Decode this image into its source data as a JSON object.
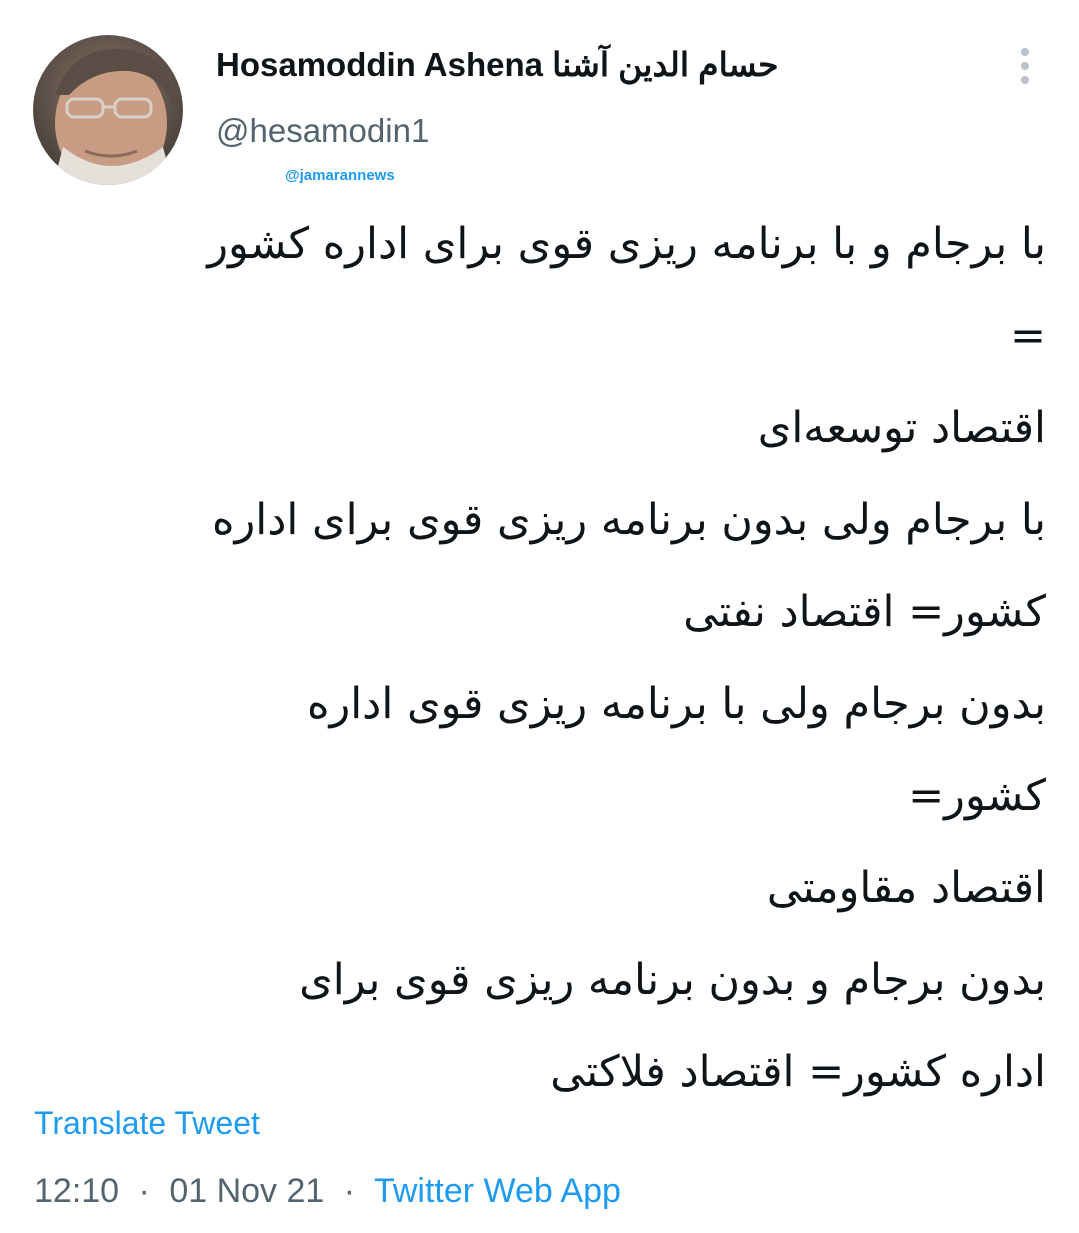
{
  "author": {
    "display_name": "Hosamoddin Ashena حسام الدین آشنا",
    "handle": "@hesamodin1"
  },
  "watermark": "@jamarannews",
  "tweet": {
    "lines": [
      "با برجام و با برنامه ریزی قوی برای اداره کشور",
      "=",
      " اقتصاد توسعه‌ای",
      "با برجام ولی بدون برنامه ریزی قوی برای اداره",
      "کشور= اقتصاد نفتی",
      "بدون برجام ولی با برنامه ریزی قوی اداره",
      "کشور=",
      " اقتصاد مقاومتی",
      "بدون برجام و بدون برنامه ریزی قوی برای",
      "اداره کشور= اقتصاد فلاکتی"
    ]
  },
  "translate_label": "Translate Tweet",
  "meta": {
    "time": "12:10",
    "date": "01 Nov 21",
    "separator": "·",
    "source": "Twitter Web App"
  },
  "icons": {
    "more": "more-vertical-icon",
    "avatar": "profile-photo"
  },
  "colors": {
    "accent": "#1d9bf0",
    "text": "#0f1419",
    "secondary": "#536471"
  }
}
